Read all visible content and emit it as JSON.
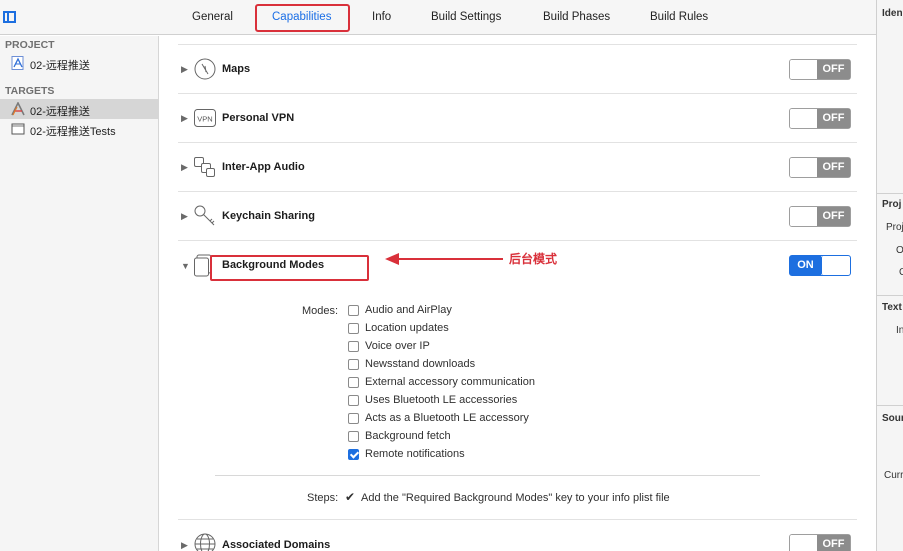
{
  "tabs": [
    {
      "label": "General"
    },
    {
      "label": "Capabilities"
    },
    {
      "label": "Info"
    },
    {
      "label": "Build Settings"
    },
    {
      "label": "Build Phases"
    },
    {
      "label": "Build Rules"
    }
  ],
  "navigator": {
    "project_header": "PROJECT",
    "project_name": "02-远程推送",
    "targets_header": "TARGETS",
    "targets": [
      {
        "label": "02-远程推送"
      },
      {
        "label": "02-远程推送Tests"
      }
    ]
  },
  "capabilities": [
    {
      "title": "Maps",
      "state": "OFF",
      "icon": "maps-icon"
    },
    {
      "title": "Personal VPN",
      "state": "OFF",
      "icon": "vpn-icon",
      "icon_text": "VPN"
    },
    {
      "title": "Inter-App Audio",
      "state": "OFF",
      "icon": "inter-app-audio-icon"
    },
    {
      "title": "Keychain Sharing",
      "state": "OFF",
      "icon": "keychain-icon"
    },
    {
      "title": "Background Modes",
      "state": "ON",
      "icon": "background-modes-icon"
    },
    {
      "title": "Associated Domains",
      "state": "OFF",
      "icon": "globe-icon"
    }
  ],
  "annotation": {
    "label": "后台模式",
    "color": "#d9303a"
  },
  "modes": {
    "label": "Modes:",
    "items": [
      {
        "label": "Audio and AirPlay",
        "checked": false
      },
      {
        "label": "Location updates",
        "checked": false
      },
      {
        "label": "Voice over IP",
        "checked": false
      },
      {
        "label": "Newsstand downloads",
        "checked": false
      },
      {
        "label": "External accessory communication",
        "checked": false
      },
      {
        "label": "Uses Bluetooth LE accessories",
        "checked": false
      },
      {
        "label": "Acts as a Bluetooth LE accessory",
        "checked": false
      },
      {
        "label": "Background fetch",
        "checked": false
      },
      {
        "label": "Remote notifications",
        "checked": true
      }
    ]
  },
  "steps": {
    "label": "Steps:",
    "check": "✔",
    "text": "Add the \"Required Background Modes\" key to your info plist file"
  },
  "inspector": {
    "identity": "Iden",
    "project_header": "Proj",
    "project_row": "Proj",
    "row_o1": "O",
    "row_o2": "C",
    "text_header": "Text",
    "text_row": "In",
    "source_header": "Sour",
    "current": "Curr"
  },
  "colors": {
    "accent": "#1d6fe0",
    "annotation": "#d9303a",
    "toggle_off": "#8c8c8c"
  }
}
